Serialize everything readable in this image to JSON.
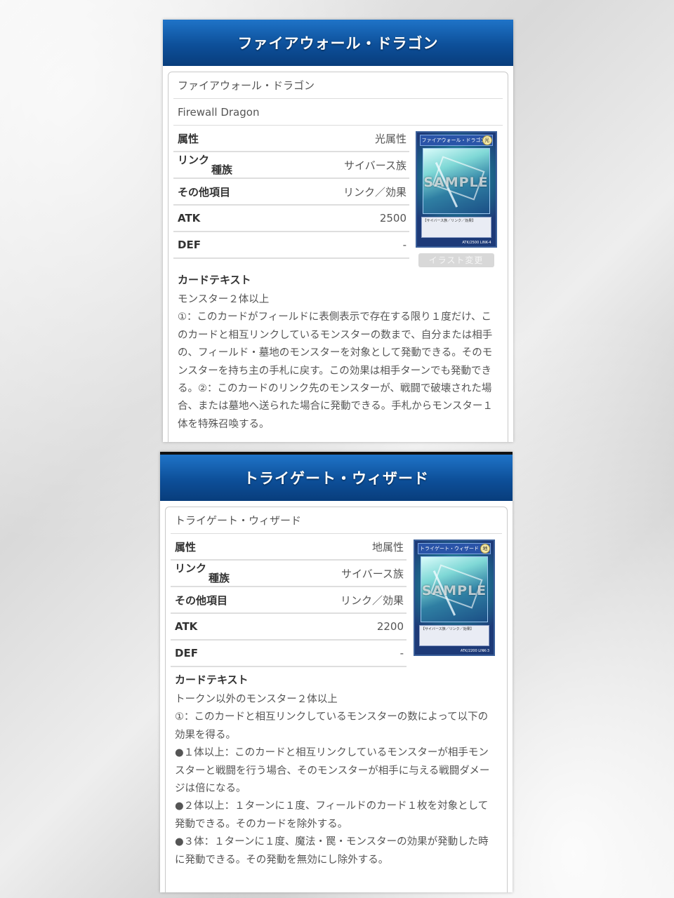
{
  "cards": [
    {
      "header_title": "ファイアウォール・ドラゴン",
      "name_ja": "ファイアウォール・ドラゴン",
      "name_en": "Firewall Dragon",
      "attribute_label": "属性",
      "attribute_value": "光属性",
      "link_label": "リンク",
      "type_label": "種族",
      "type_value": "サイバース族",
      "other_label": "その他項目",
      "other_value": "リンク／効果",
      "atk_label": "ATK",
      "atk_value": "2500",
      "def_label": "DEF",
      "def_value": "-",
      "card_name_on_image": "ファイアウォール・ドラゴン",
      "card_attr_on_image": "光",
      "sample_watermark": "SAMPLE",
      "card_type_line": "【サイバース族／リンク／効果】",
      "card_stats": "ATK/2500 LINK-4",
      "change_button": "イラスト変更",
      "text_heading": "カードテキスト",
      "text_lines": [
        "モンスター２体以上",
        "①：このカードがフィールドに表側表示で存在する限り１度だけ、このカードと相互リンクしているモンスターの数まで、自分または相手の、フィールド・墓地のモンスターを対象として発動できる。そのモンスターを持ち主の手札に戻す。この効果は相手ターンでも発動できる。②：このカードのリンク先のモンスターが、戦闘で破壊された場合、または墓地へ送られた場合に発動できる。手札からモンスター１体を特殊召喚する。"
      ]
    },
    {
      "header_title": "トライゲート・ウィザード",
      "name_ja": "トライゲート・ウィザード",
      "attribute_label": "属性",
      "attribute_value": "地属性",
      "link_label": "リンク",
      "type_label": "種族",
      "type_value": "サイバース族",
      "other_label": "その他項目",
      "other_value": "リンク／効果",
      "atk_label": "ATK",
      "atk_value": "2200",
      "def_label": "DEF",
      "def_value": "-",
      "card_name_on_image": "トライゲート・ウィザード",
      "card_attr_on_image": "地",
      "sample_watermark": "SAMPLE",
      "card_type_line": "【サイバース族／リンク／効果】",
      "card_stats": "ATK/2200 LINK-3",
      "text_heading": "カードテキスト",
      "text_lines": [
        "トークン以外のモンスター２体以上",
        "①：このカードと相互リンクしているモンスターの数によって以下の効果を得る。",
        "●１体以上：このカードと相互リンクしているモンスターが相手モンスターと戦闘を行う場合、そのモンスターが相手に与える戦闘ダメージは倍になる。",
        "●２体以上：１ターンに１度、フィールドのカード１枚を対象として発動できる。そのカードを除外する。",
        "●３体：１ターンに１度、魔法・罠・モンスターの効果が発動した時に発動できる。その発動を無効にし除外する。"
      ]
    }
  ],
  "colors": {
    "header_blue_top": "#1f74c8",
    "header_blue_bottom": "#083d7c",
    "button_gray": "#d8d8d8"
  }
}
